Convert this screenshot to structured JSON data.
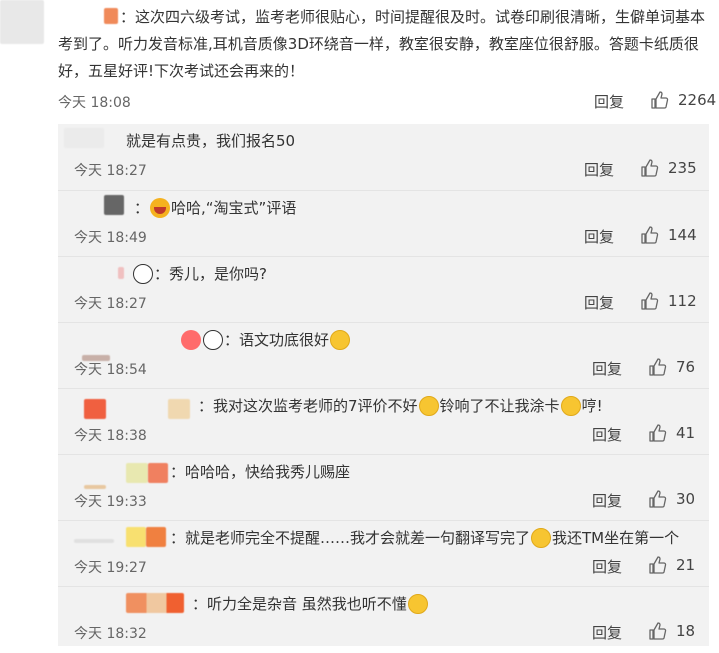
{
  "main": {
    "text": "：这次四六级考试，监考老师很贴心，时间提醒很及时。试卷印刷很清晰，生僻单词基本考到了。听力发音标准,耳机音质像3D环绕音一样，教室很安静，教室座位很舒服。答题卡纸质很好，五星好评!下次考试还会再来的！",
    "time": "今天 18:08",
    "reply_label": "回复",
    "likes": "2264"
  },
  "replies": [
    {
      "text": "就是有点贵，我们报名50",
      "time": "今天 18:27",
      "reply_label": "回复",
      "likes": "235"
    },
    {
      "text_before": "：",
      "text_after": "哈哈,“淘宝式”评语",
      "time": "今天 18:49",
      "reply_label": "回复",
      "likes": "144"
    },
    {
      "text_before": "：秀儿，是你吗?",
      "time": "今天 18:27",
      "reply_label": "回复",
      "likes": "112"
    },
    {
      "text_before": "：语文功底很好",
      "time": "今天 18:54",
      "reply_label": "回复",
      "likes": "76"
    },
    {
      "text_before": "：我对这次监考老师的7评价不好",
      "text_mid": "铃响了不让我涂卡",
      "text_after": "哼!",
      "time": "今天 18:38",
      "reply_label": "回复",
      "likes": "41"
    },
    {
      "text_before": "：哈哈哈，快给我秀儿赐座",
      "time": "今天 19:33",
      "reply_label": "回复",
      "likes": "30"
    },
    {
      "text_before": "：就是老师完全不提醒……我才会就差一句翻译写完了",
      "text_after": "我还TM坐在第一个",
      "time": "今天 19:27",
      "reply_label": "回复",
      "likes": "21"
    },
    {
      "text_before": "：听力全是杂音 虽然我也听不懂",
      "time": "今天 18:32",
      "reply_label": "回复",
      "likes": "18"
    }
  ]
}
